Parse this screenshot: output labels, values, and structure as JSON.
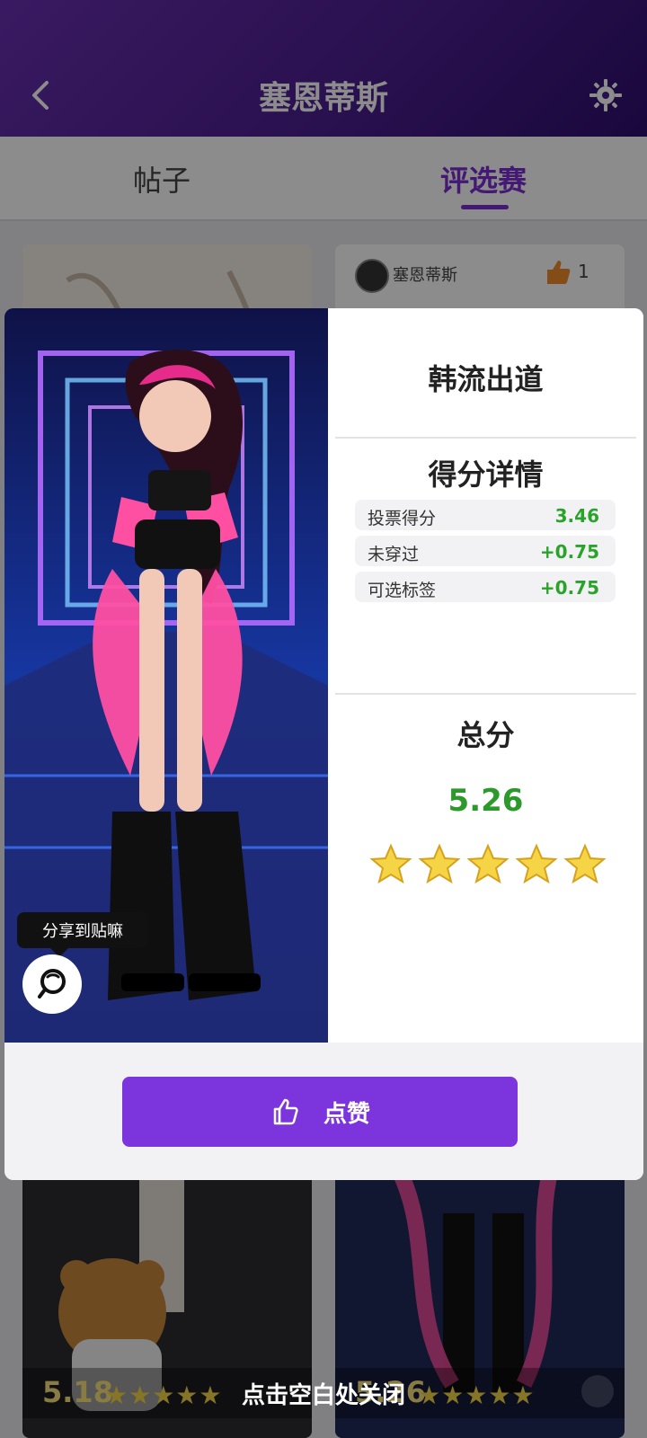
{
  "header": {
    "title": "塞恩蒂斯",
    "icons": [
      "back-arrow-icon",
      "gear-icon"
    ]
  },
  "tabs": [
    {
      "label": "帖子"
    },
    {
      "label": "评选赛"
    }
  ],
  "background_cards": {
    "right_top": {
      "user": "塞恩蒂斯",
      "likes": "1"
    },
    "left_bottom": {
      "score": "5.18"
    },
    "right_bottom": {
      "score": "5.26"
    }
  },
  "modal": {
    "look_title": "韩流出道",
    "section_title": "得分详情",
    "details": [
      {
        "label": "投票得分",
        "value": "3.46"
      },
      {
        "label": "未穿过",
        "value": "+0.75"
      },
      {
        "label": "可选标签",
        "value": "+0.75"
      }
    ],
    "total_title": "总分",
    "total_score": "5.26",
    "star_count": 5,
    "share_tooltip": "分享到贴嘛",
    "like_button_label": "点赞"
  },
  "close_hint": "点击空白处关闭",
  "colors": {
    "accent_purple": "#7c35dd",
    "score_green": "#29a329",
    "star_yellow": "#f5d546"
  }
}
